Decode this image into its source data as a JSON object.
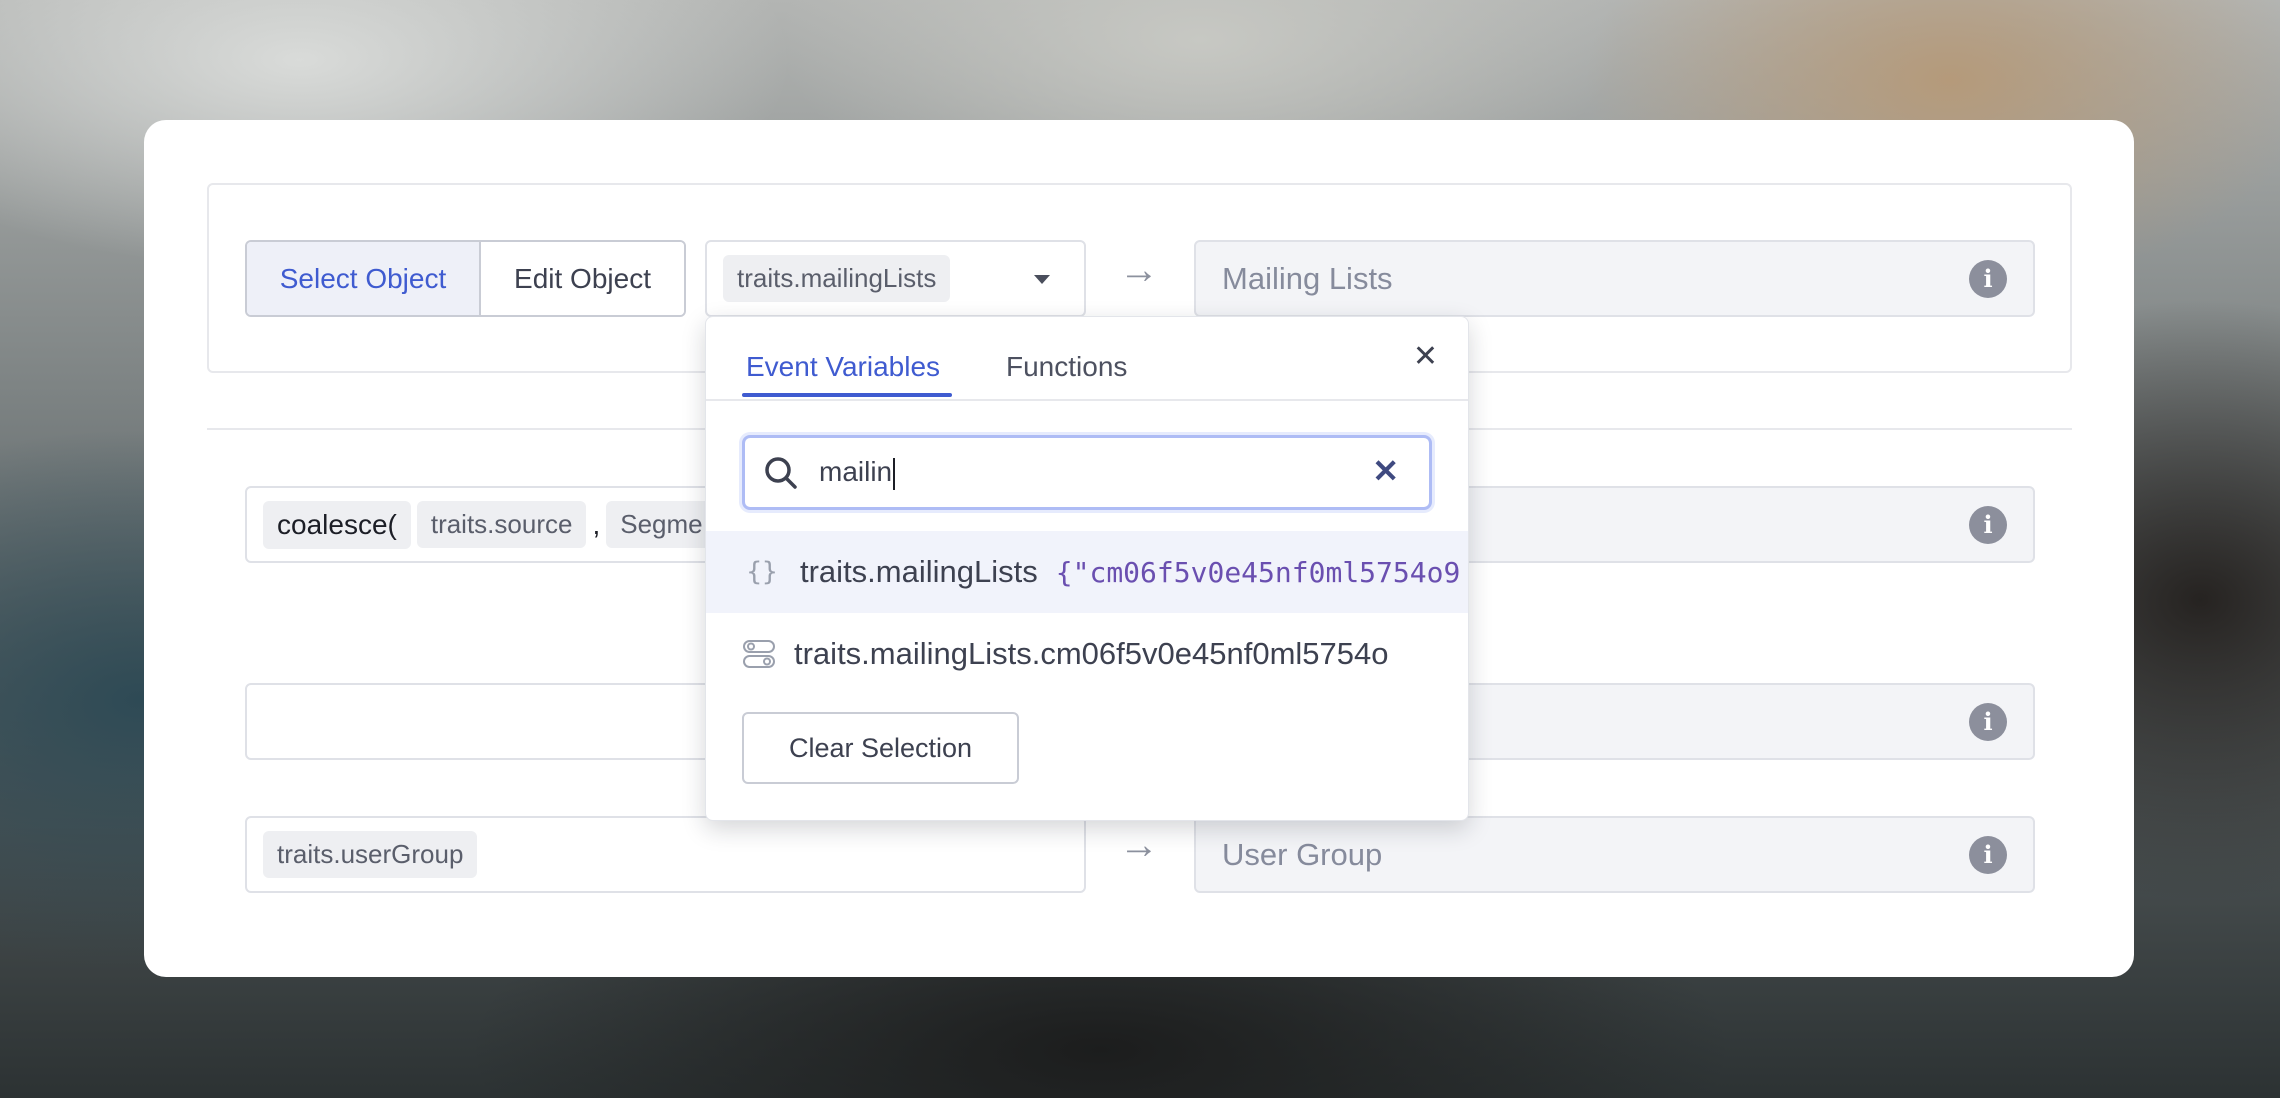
{
  "mapping": {
    "object_mode": {
      "select_label": "Select Object",
      "edit_label": "Edit Object"
    },
    "row1": {
      "source_chip": "traits.mailingLists",
      "target": "Mailing Lists"
    },
    "row2": {
      "fn_chip": "coalesce(",
      "arg1_chip": "traits.source",
      "comma": ",",
      "arg2_chip": "Segme"
    },
    "row3": {},
    "row4": {
      "source_chip": "traits.userGroup",
      "target": "User Group"
    }
  },
  "popup": {
    "tabs": [
      {
        "label": "Event Variables"
      },
      {
        "label": "Functions"
      }
    ],
    "search": {
      "value": "mailin"
    },
    "results": [
      {
        "label": "traits.mailingLists",
        "value": "{\"cm06f5v0e45nf0ml5754o9"
      },
      {
        "label": "traits.mailingLists.cm06f5v0e45nf0ml5754o"
      }
    ],
    "clear_label": "Clear Selection"
  },
  "icons": {
    "arrow": "arrow-right-icon",
    "info": "info-icon",
    "search": "search-icon",
    "close": "close-icon",
    "object": "braces-icon",
    "toggle": "toggle-icon"
  }
}
